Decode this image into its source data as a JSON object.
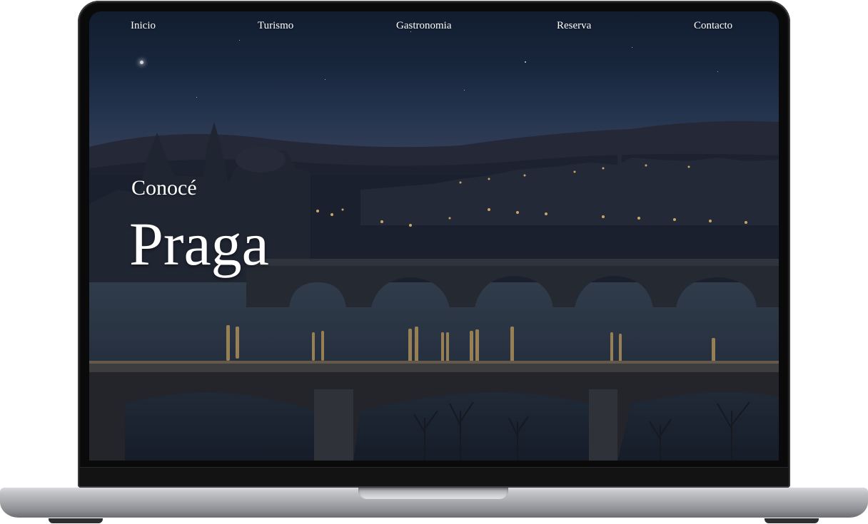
{
  "nav": {
    "items": [
      {
        "label": "Inicio"
      },
      {
        "label": "Turismo"
      },
      {
        "label": "Gastronomia"
      },
      {
        "label": "Reserva"
      },
      {
        "label": "Contacto"
      }
    ]
  },
  "hero": {
    "kicker": "Conocé",
    "title": "Praga"
  },
  "colors": {
    "text": "#ffffff",
    "night_sky": "#1d2b44",
    "lights": "#f3c77a",
    "laptop_body": "#bfc1c5"
  },
  "hero_image": "prague-charles-bridge-night-photo"
}
